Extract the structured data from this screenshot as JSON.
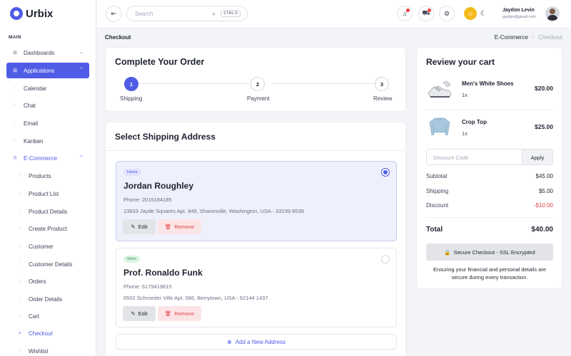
{
  "brand": {
    "name": "Urbix"
  },
  "sidebar": {
    "section": "MAIN",
    "items": [
      {
        "label": "Dashboards",
        "icon": "grid-icon"
      },
      {
        "label": "Applications",
        "icon": "apps-icon"
      }
    ],
    "apps": [
      "Calendar",
      "Chat",
      "Email",
      "Kanban"
    ],
    "ecommerce": {
      "label": "E-Commerce",
      "icon": "tag-icon"
    },
    "ecom_items": [
      "Products",
      "Product List",
      "Product Details",
      "Create Product",
      "Customer",
      "Customer Details",
      "Orders",
      "Order Details",
      "Cart",
      "Checkout",
      "Wishlist"
    ]
  },
  "header": {
    "search_placeholder": "Search",
    "search_shortcut": "CTRL D",
    "user_name": "Jaydon Levin",
    "user_email": "jaydon@gmail.com"
  },
  "page": {
    "title": "Checkout",
    "breadcrumb": [
      "E-Commerce",
      "Checkout"
    ]
  },
  "order": {
    "title": "Complete Your Order",
    "steps": [
      {
        "num": "1",
        "label": "Shipping"
      },
      {
        "num": "2",
        "label": "Payment"
      },
      {
        "num": "3",
        "label": "Review"
      }
    ],
    "current_step": 1
  },
  "shipping": {
    "title": "Select Shipping Address",
    "addresses": [
      {
        "tag": "Home",
        "name": "Jordan Roughley",
        "phone": "Phone: 2015184185",
        "street": "13833 Jayde Squares Apt. 849, Sharonville, Washington, USA - 33199 8539",
        "selected": true
      },
      {
        "tag": "Work",
        "name": "Prof. Ronaldo Funk",
        "phone": "Phone: 6179419815",
        "street": "6502 Schroeder Ville Apt. 066, Berrytown, USA - 62144 1437",
        "selected": false
      }
    ],
    "edit_label": "Edit",
    "remove_label": "Remove",
    "add_label": "Add a New Address"
  },
  "cart": {
    "title": "Review your cart",
    "items": [
      {
        "name": "Men's White Shoes",
        "qty": "1x",
        "price": "$20.00"
      },
      {
        "name": "Crop Top",
        "qty": "1x",
        "price": "$25.00"
      }
    ],
    "discount_placeholder": "Discount Code",
    "apply_label": "Apply",
    "summary": [
      {
        "label": "Subtotal",
        "value": "$45.00"
      },
      {
        "label": "Shipping",
        "value": "$5.00"
      },
      {
        "label": "Discount",
        "value": "-$10.00"
      }
    ],
    "total_label": "Total",
    "total_value": "$40.00",
    "secure_label": "Secure Checkout - SSL Encrypted",
    "note": "Ensuring your financial and personal details are secure during every transaction."
  },
  "colors": {
    "accent": "#4f5ce6",
    "danger": "#e0454e",
    "success": "#2e9c58",
    "warning": "#f5b91b"
  }
}
